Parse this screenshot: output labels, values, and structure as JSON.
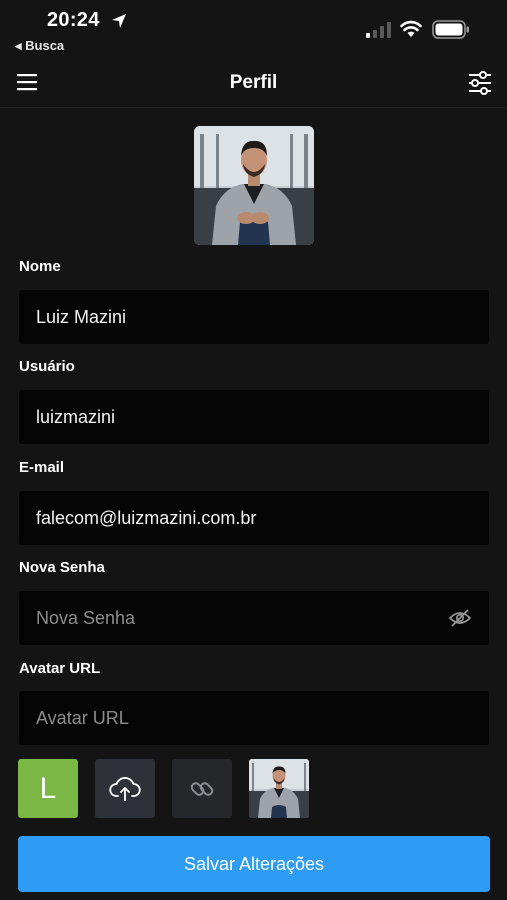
{
  "status_bar": {
    "time": "20:24",
    "back_app": "◂ Busca"
  },
  "nav": {
    "title": "Perfil"
  },
  "form": {
    "name_label": "Nome",
    "name_value": "Luiz Mazini",
    "user_label": "Usuário",
    "user_value": "luizmazini",
    "email_label": "E-mail",
    "email_value": "falecom@luizmazini.com.br",
    "password_label": "Nova Senha",
    "password_placeholder": "Nova Senha",
    "avatar_url_label": "Avatar URL",
    "avatar_url_placeholder": "Avatar URL"
  },
  "avatar_options": {
    "letter": "L",
    "letter_color": "#7ab744"
  },
  "save_button": "Salvar Alterações",
  "colors": {
    "background": "#141414",
    "input_bg": "#050505",
    "primary": "#2e9bf5"
  }
}
